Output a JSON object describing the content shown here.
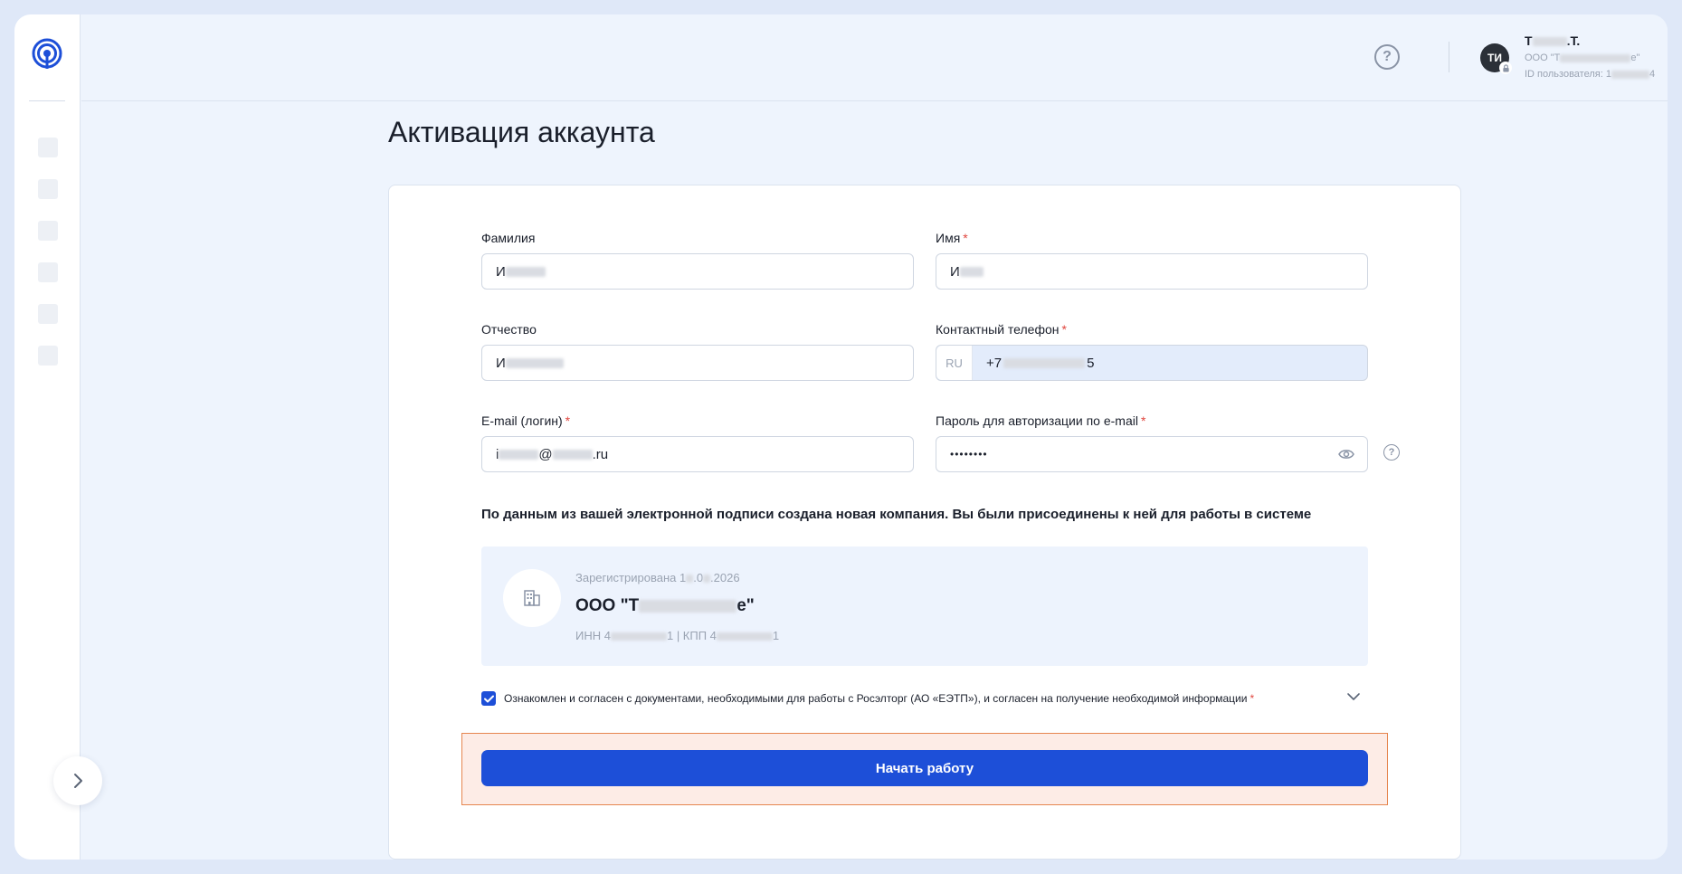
{
  "header": {
    "help_label": "?",
    "avatar_initials": "ТИ",
    "user_name_start": "Т",
    "user_name_end": ".Т.",
    "org_start": "ООО \"Т",
    "org_end": "е\"",
    "user_id_label": "ID пользователя: 1",
    "user_id_end": "4"
  },
  "page": {
    "title": "Активация аккаунта"
  },
  "form": {
    "lastname": {
      "label": "Фамилия",
      "value": "И"
    },
    "firstname": {
      "label": "Имя",
      "required_mark": "*",
      "value": "И"
    },
    "middlename": {
      "label": "Отчество",
      "value": "И"
    },
    "phone": {
      "label": "Контактный телефон",
      "required_mark": "*",
      "country": "RU",
      "value_start": "+7",
      "value_end": "5"
    },
    "email": {
      "label": "E-mail (логин)",
      "required_mark": "*",
      "value_start": "i",
      "value_mid": "@",
      "value_end": ".ru"
    },
    "password": {
      "label": "Пароль для авторизации по e-mail",
      "required_mark": "*",
      "value": "••••••••"
    }
  },
  "notice": "По данным из вашей электронной подписи создана новая компания. Вы были присоединены к ней для работы в системе",
  "company": {
    "registered_label": "Зарегистрирована 1",
    "registered_mid": ".0",
    "registered_end": ".2026",
    "name_start": "ООО \"Т",
    "name_end": "е\"",
    "inn_label": "ИНН 4",
    "inn_end": "1",
    "kpp_label": " | КПП 4",
    "kpp_end": "1"
  },
  "agreement": {
    "checked": true,
    "text": "Ознакомлен и согласен с документами, необходимыми для работы с Росэлторг (АО «ЕЭТП»), и согласен на получение необходимой информации",
    "required_mark": "*"
  },
  "cta": {
    "label": "Начать работу"
  },
  "colors": {
    "accent": "#1d4fd8",
    "required": "#e0463e",
    "cta_highlight": "#e6864f"
  }
}
